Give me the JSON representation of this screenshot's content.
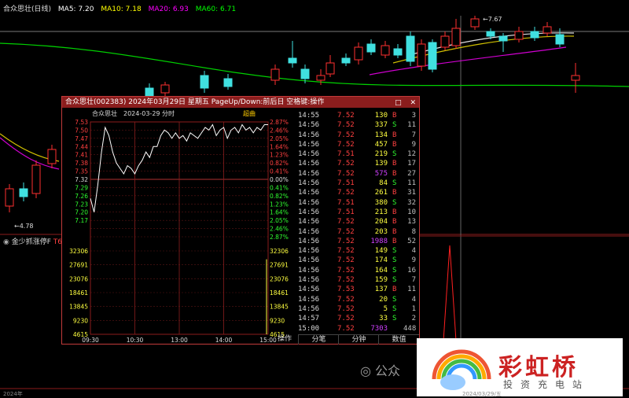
{
  "header": {
    "stock_label": "合众思壮(日线)",
    "ma5": "MA5: 7.20",
    "ma10": "MA10: 7.18",
    "ma20": "MA20: 6.93",
    "ma60": "MA60: 6.71",
    "colors": {
      "ma5": "#ffffff",
      "ma10": "#ffff00",
      "ma20": "#ff00ff",
      "ma60": "#00ff00"
    }
  },
  "main_chart": {
    "high_label": "7.67",
    "low_label": "4.78",
    "indicator_label": "金少抓涨停F",
    "indicator_value": "T6",
    "bottom_left": "2024年",
    "bottom_right": "2024/03/29/五"
  },
  "popup": {
    "title": "合众思壮(002383) 2024年03月29日 星期五 PageUp/Down:前后日 空格键:操作",
    "btn_restore": "□",
    "btn_close": "✕",
    "subtitle_name": "合众思壮",
    "subtitle_date": "2024-03-29 分时",
    "overlay_label": "超曲",
    "ops_label": "操作",
    "tabs": [
      "分笔",
      "分钟",
      "数值"
    ]
  },
  "chart_data": {
    "type": "line",
    "title": "合众思壮 2024-03-29 分时",
    "price_ticks": [
      "7.53",
      "7.50",
      "7.47",
      "7.44",
      "7.41",
      "7.38",
      "7.35",
      "7.32",
      "7.29",
      "7.26",
      "7.23",
      "7.20",
      "7.17"
    ],
    "pct_ticks": [
      "2.87%",
      "2.46%",
      "2.05%",
      "1.64%",
      "1.23%",
      "0.82%",
      "0.41%",
      "0.00%",
      "0.41%",
      "0.82%",
      "1.23%",
      "1.64%",
      "2.05%",
      "2.46%",
      "2.87%"
    ],
    "vol_ticks": [
      "32306",
      "27691",
      "23076",
      "18461",
      "13845",
      "9230",
      "4615"
    ],
    "time_ticks": [
      "09:30",
      "10:30",
      "13:00",
      "14:00",
      "15:00"
    ],
    "prev_close": 7.32,
    "ylim": [
      7.11,
      7.53
    ],
    "minutes": [
      0,
      5,
      10,
      15,
      20,
      25,
      30,
      35,
      40,
      45,
      50,
      55,
      60,
      65,
      70,
      75,
      80,
      85,
      90,
      95,
      100,
      105,
      110,
      115,
      120,
      125,
      130,
      135,
      140,
      145,
      150,
      155,
      160,
      165,
      170,
      175,
      180,
      185,
      190,
      195,
      200,
      205,
      210,
      215,
      220,
      225,
      230,
      235,
      240
    ],
    "price": [
      7.25,
      7.2,
      7.3,
      7.42,
      7.51,
      7.48,
      7.42,
      7.38,
      7.36,
      7.34,
      7.37,
      7.36,
      7.34,
      7.37,
      7.39,
      7.42,
      7.4,
      7.44,
      7.44,
      7.48,
      7.5,
      7.49,
      7.47,
      7.49,
      7.47,
      7.48,
      7.46,
      7.49,
      7.48,
      7.47,
      7.49,
      7.51,
      7.5,
      7.52,
      7.48,
      7.5,
      7.51,
      7.47,
      7.5,
      7.51,
      7.49,
      7.52,
      7.5,
      7.51,
      7.49,
      7.51,
      7.5,
      7.52,
      7.52
    ],
    "volume_max": 32306
  },
  "trades": [
    {
      "time": "14:55",
      "price": "7.52",
      "vol": "130",
      "side": "B",
      "num": "3"
    },
    {
      "time": "14:56",
      "price": "7.52",
      "vol": "337",
      "side": "S",
      "num": "11"
    },
    {
      "time": "14:56",
      "price": "7.52",
      "vol": "134",
      "side": "B",
      "num": "7"
    },
    {
      "time": "14:56",
      "price": "7.52",
      "vol": "457",
      "side": "B",
      "num": "9"
    },
    {
      "time": "14:56",
      "price": "7.51",
      "vol": "219",
      "side": "S",
      "num": "12"
    },
    {
      "time": "14:56",
      "price": "7.52",
      "vol": "139",
      "side": "B",
      "num": "17"
    },
    {
      "time": "14:56",
      "price": "7.52",
      "vol": "575",
      "side": "B",
      "num": "27"
    },
    {
      "time": "14:56",
      "price": "7.51",
      "vol": "84",
      "side": "S",
      "num": "11"
    },
    {
      "time": "14:56",
      "price": "7.52",
      "vol": "261",
      "side": "B",
      "num": "31"
    },
    {
      "time": "14:56",
      "price": "7.51",
      "vol": "380",
      "side": "S",
      "num": "32"
    },
    {
      "time": "14:56",
      "price": "7.51",
      "vol": "213",
      "side": "B",
      "num": "10"
    },
    {
      "time": "14:56",
      "price": "7.52",
      "vol": "204",
      "side": "B",
      "num": "13"
    },
    {
      "time": "14:56",
      "price": "7.52",
      "vol": "203",
      "side": "B",
      "num": "8"
    },
    {
      "time": "14:56",
      "price": "7.52",
      "vol": "1988",
      "side": "B",
      "num": "52"
    },
    {
      "time": "14:56",
      "price": "7.52",
      "vol": "149",
      "side": "S",
      "num": "4"
    },
    {
      "time": "14:56",
      "price": "7.52",
      "vol": "174",
      "side": "S",
      "num": "9"
    },
    {
      "time": "14:56",
      "price": "7.52",
      "vol": "164",
      "side": "S",
      "num": "16"
    },
    {
      "time": "14:56",
      "price": "7.52",
      "vol": "159",
      "side": "S",
      "num": "7"
    },
    {
      "time": "14:56",
      "price": "7.53",
      "vol": "137",
      "side": "B",
      "num": "11"
    },
    {
      "time": "14:56",
      "price": "7.52",
      "vol": "20",
      "side": "S",
      "num": "4"
    },
    {
      "time": "14:56",
      "price": "7.52",
      "vol": "5",
      "side": "S",
      "num": "1"
    },
    {
      "time": "14:57",
      "price": "7.52",
      "vol": "33",
      "side": "S",
      "num": "2"
    },
    {
      "time": "15:00",
      "price": "7.52",
      "vol": "7303",
      "side": "",
      "num": "448"
    }
  ],
  "watermark": {
    "wechat": "公众",
    "brand": "彩虹桥",
    "brand_sub": "投资充电站"
  }
}
